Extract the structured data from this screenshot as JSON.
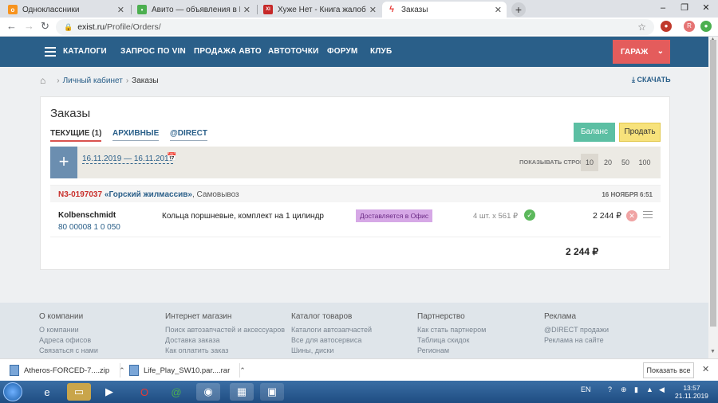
{
  "browser": {
    "tabs": [
      {
        "label": "Одноклассники",
        "favicon_color": "#f7931e",
        "favicon_char": "о"
      },
      {
        "label": "Авито — объявления в Новосиб",
        "favicon_color": "#4caf50",
        "favicon_char": "•"
      },
      {
        "label": "Хуже Нет - Книга жалоб, Отзыв",
        "favicon_color": "#c62828",
        "favicon_char": "XI"
      },
      {
        "label": "Заказы",
        "favicon_color": "#e53935",
        "favicon_char": "ϟ"
      }
    ],
    "address": {
      "host": "exist.ru",
      "path": "/Profile/Orders/"
    },
    "window_controls": [
      "–",
      "❐",
      "✕"
    ]
  },
  "site_nav": {
    "items": [
      "КАТАЛОГИ",
      "ЗАПРОС ПО VIN",
      "ПРОДАЖА АВТО",
      "АВТОТОЧКИ",
      "ФОРУМ",
      "КЛУБ"
    ],
    "garage": "ГАРАЖ"
  },
  "breadcrumb": {
    "items": [
      "Личный кабинет",
      "Заказы"
    ],
    "download": "СКАЧАТЬ"
  },
  "orders": {
    "title": "Заказы",
    "tabs": [
      "ТЕКУЩИЕ (1)",
      "АРХИВНЫЕ",
      "@DIRECT"
    ],
    "balance_btn": "Баланс",
    "sell_btn": "Продать",
    "add_icon": "+",
    "date_range": "16.11.2019 — 16.11.2019",
    "show_rows_label": "ПОКАЗЫВАТЬ СТРОК:",
    "row_options": [
      "10",
      "20",
      "50",
      "100"
    ],
    "selected_rows": "10",
    "order": {
      "number": "N3-0197037",
      "site": "«Горский жилмассив»",
      "delivery": ", Самовывоз",
      "date": "16 НОЯБРЯ 6:51",
      "item": {
        "brand": "Kolbenschmidt",
        "article": "80 00008 1 0 050",
        "description": "Кольца поршневые, комплект на 1 цилиндр",
        "status": "Доставляется в Офис",
        "qty": "4 шт. х 561 ₽",
        "price": "2 244 ₽"
      },
      "total": "2 244 ₽"
    }
  },
  "footer": {
    "columns": [
      {
        "heading": "О компании",
        "links": [
          "О компании",
          "Адреса офисов",
          "Связаться с нами"
        ]
      },
      {
        "heading": "Интернет магазин",
        "links": [
          "Поиск автозапчастей и аксессуаров",
          "Доставка заказа",
          "Как оплатить заказ"
        ]
      },
      {
        "heading": "Каталог товаров",
        "links": [
          "Каталоги автозапчастей",
          "Все для автосервиса",
          "Шины, диски"
        ]
      },
      {
        "heading": "Партнерство",
        "links": [
          "Как стать партнером",
          "Таблица скидок",
          "Регионам"
        ]
      },
      {
        "heading": "Реклама",
        "links": [
          "@DIRECT продажи",
          "Реклама на сайте"
        ]
      }
    ]
  },
  "downloads": {
    "files": [
      "Atheros-FORCED-7....zip",
      "Life_Play_SW10.par....rar"
    ],
    "show_all": "Показать все"
  },
  "taskbar": {
    "lang": "EN",
    "time": "13:57",
    "date": "21.11.2019"
  }
}
